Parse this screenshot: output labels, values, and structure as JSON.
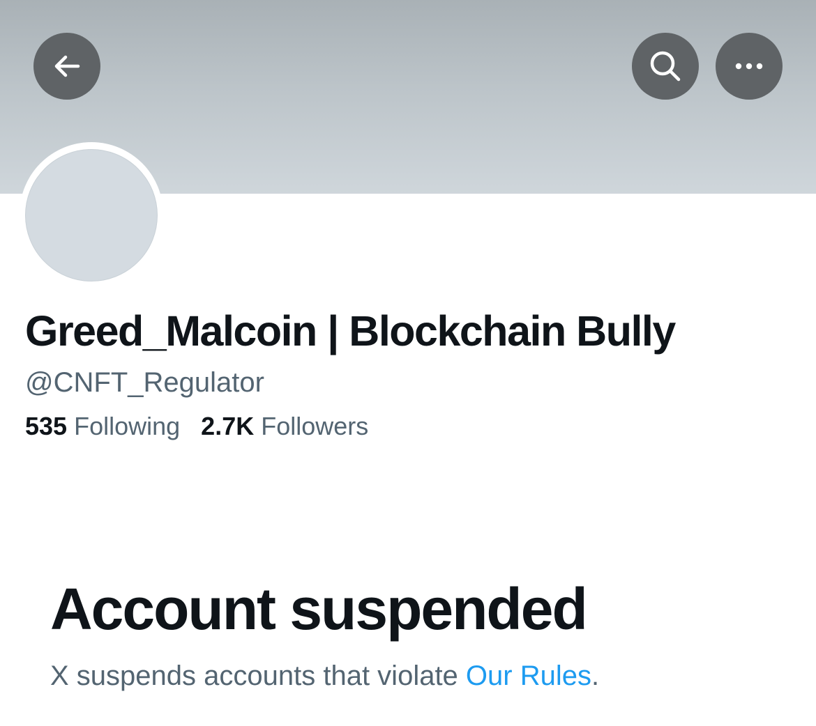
{
  "header": {
    "back_icon": "arrow-left-icon",
    "search_icon": "search-icon",
    "more_icon": "more-horizontal-icon"
  },
  "profile": {
    "display_name": "Greed_Malcoin | Blockchain Bully",
    "handle": "@CNFT_Regulator",
    "following_count": "535",
    "following_label": "Following",
    "followers_count": "2.7K",
    "followers_label": "Followers"
  },
  "suspension": {
    "title": "Account suspended",
    "message_prefix": "X suspends accounts that violate ",
    "rules_link": "Our Rules",
    "message_suffix": "."
  },
  "colors": {
    "text_primary": "#0f1419",
    "text_secondary": "#536471",
    "link": "#1d9bf0",
    "button_bg": "#5f6366"
  }
}
